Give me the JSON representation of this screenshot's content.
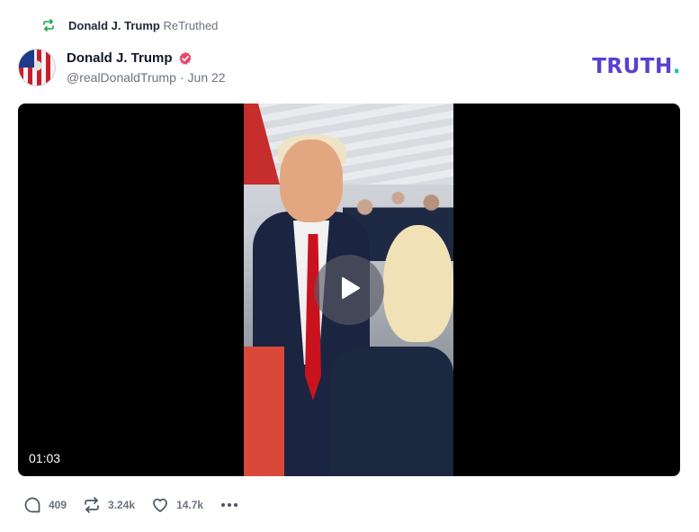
{
  "retruth": {
    "name": "Donald J. Trump",
    "suffix": "ReTruthed",
    "icon": "retruth-icon",
    "color": "#16a34a"
  },
  "post": {
    "display_name": "Donald J. Trump",
    "handle": "@realDonaldTrump",
    "separator": "·",
    "date": "Jun 22",
    "verified_color": "#e4486b"
  },
  "brand": {
    "logo_text": "TRUTH",
    "logo_dot": ".",
    "color": "#5b3fd1",
    "dot_color": "#13c4a7"
  },
  "video": {
    "duration": "01:03",
    "play_icon": "play-icon"
  },
  "actions": {
    "replies": {
      "icon": "reply-icon",
      "count": "409"
    },
    "retruths": {
      "icon": "retruth-icon",
      "count": "3.24k"
    },
    "likes": {
      "icon": "heart-icon",
      "count": "14.7k"
    },
    "more": {
      "icon": "more-icon"
    }
  }
}
